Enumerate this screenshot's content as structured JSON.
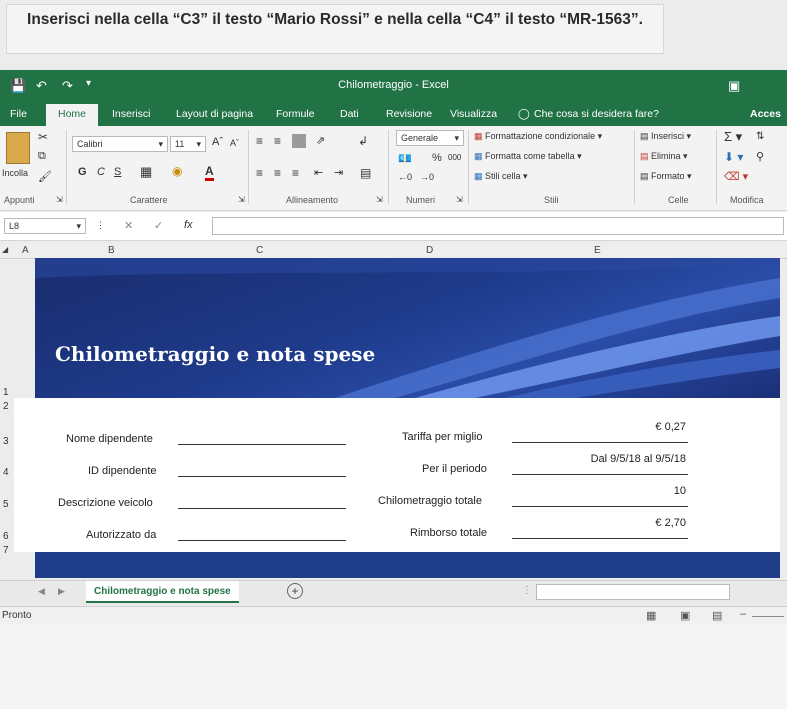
{
  "task": {
    "text": "Inserisci nella cella “C3” il testo “Mario Rossi” e nella cella “C4” il testo “MR-1563”."
  },
  "window": {
    "title": "Chilometraggio - Excel"
  },
  "tabs": [
    "File",
    "Home",
    "Inserisci",
    "Layout di pagina",
    "Formule",
    "Dati",
    "Revisione",
    "Visualizza"
  ],
  "tell_me": "Che cosa si desidera fare?",
  "access": "Acces",
  "ribbon": {
    "clipboard": {
      "paste": "Incolla",
      "label": "Appunti"
    },
    "font": {
      "name": "Calibri",
      "size": "11",
      "bold": "G",
      "italic": "C",
      "underline": "S",
      "label": "Carattere"
    },
    "alignment": {
      "label": "Allineamento"
    },
    "number": {
      "format": "Generale",
      "percent": "%",
      "thousands": "000",
      "label": "Numeri"
    },
    "styles": {
      "cond": "Formattazione condizionale",
      "table": "Formatta come tabella",
      "cell": "Stili cella",
      "label": "Stili"
    },
    "cells": {
      "insert": "Inserisci",
      "delete": "Elimina",
      "format": "Formato",
      "label": "Celle"
    },
    "editing": {
      "label": "Modifica"
    }
  },
  "formula_bar": {
    "name_box": "L8",
    "fx": "fx",
    "formula": ""
  },
  "columns": [
    "A",
    "B",
    "C",
    "D",
    "E"
  ],
  "rows": [
    "1",
    "2",
    "3",
    "4",
    "5",
    "6",
    "7"
  ],
  "banner": {
    "title": "Chilometraggio e nota spese"
  },
  "form": {
    "left": [
      {
        "label": "Nome dipendente",
        "value": ""
      },
      {
        "label": "ID dipendente",
        "value": ""
      },
      {
        "label": "Descrizione veicolo",
        "value": ""
      },
      {
        "label": "Autorizzato da",
        "value": ""
      }
    ],
    "right": [
      {
        "label": "Tariffa per miglio",
        "value": "€ 0,27"
      },
      {
        "label": "Per il periodo",
        "value": "Dal 9/5/18 al 9/5/18"
      },
      {
        "label": "Chilometraggio totale",
        "value": "10"
      },
      {
        "label": "Rimborso totale",
        "value": "€ 2,70"
      }
    ]
  },
  "sheet_tab": "Chilometraggio e nota spese",
  "status": {
    "ready": "Pronto"
  },
  "colors": {
    "excel_green": "#217346",
    "banner_blue": "#1e3a8a"
  }
}
